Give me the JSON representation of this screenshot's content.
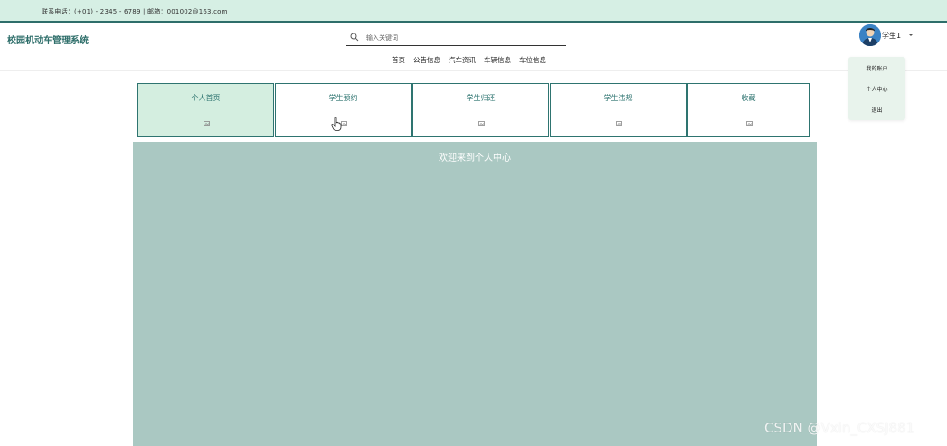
{
  "topbar": {
    "contact": "联系电话：(+01) - 2345 - 6789 | 邮箱：001002@163.com"
  },
  "header": {
    "site_title": "校园机动车管理系统",
    "search": {
      "placeholder": "输入关键词",
      "value": ""
    },
    "nav": [
      "首页",
      "公告信息",
      "汽车资讯",
      "车辆信息",
      "车位信息"
    ],
    "user": {
      "name": "学生1"
    }
  },
  "dropdown": {
    "items": [
      "我的账户",
      "个人中心",
      "退出"
    ]
  },
  "tabs": [
    {
      "label": "个人首页",
      "active": true
    },
    {
      "label": "学生预约",
      "active": false
    },
    {
      "label": "学生归还",
      "active": false
    },
    {
      "label": "学生违规",
      "active": false
    },
    {
      "label": "收藏",
      "active": false
    }
  ],
  "panel": {
    "welcome": "欢迎来到个人中心"
  },
  "watermark": "CSDN @Vxin_CXSJ881",
  "colors": {
    "primary": "#2e7470",
    "topbar_bg": "#d6efe4",
    "active_tab_bg": "#d4eee0",
    "panel_bg": "#aac8c2",
    "dropdown_bg": "#e8f3ec"
  }
}
